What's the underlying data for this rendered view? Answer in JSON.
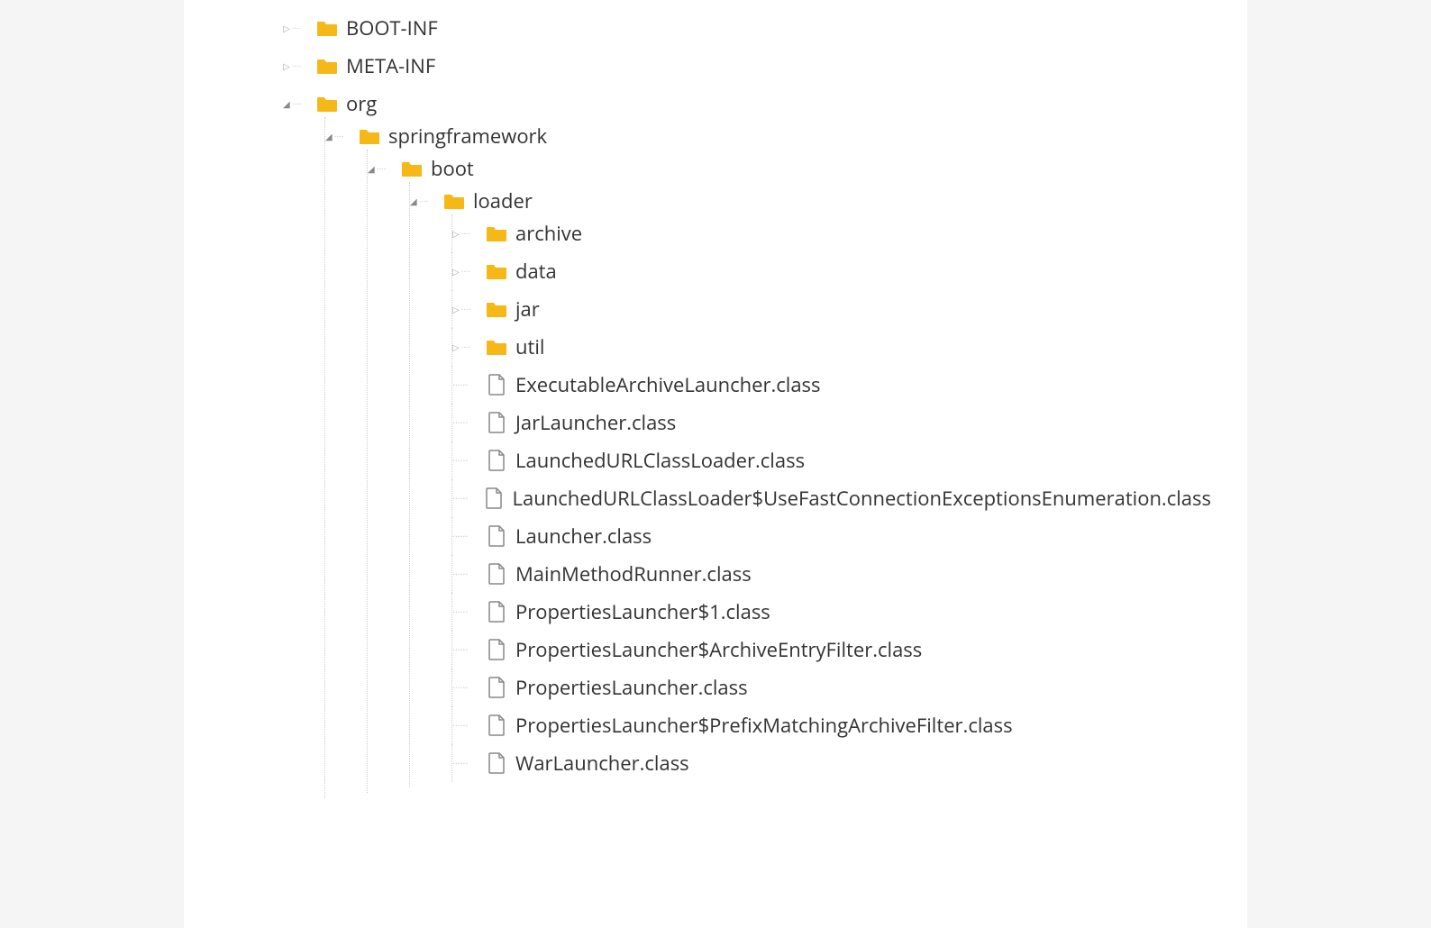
{
  "colors": {
    "folder": "#f5b817",
    "file_stroke": "#888888",
    "text": "#333333"
  },
  "tree": [
    {
      "type": "folder",
      "state": "collapsed",
      "label": "BOOT-INF"
    },
    {
      "type": "folder",
      "state": "collapsed",
      "label": "META-INF"
    },
    {
      "type": "folder",
      "state": "expanded",
      "label": "org",
      "children": [
        {
          "type": "folder",
          "state": "expanded",
          "label": "springframework",
          "children": [
            {
              "type": "folder",
              "state": "expanded",
              "label": "boot",
              "children": [
                {
                  "type": "folder",
                  "state": "expanded",
                  "label": "loader",
                  "children": [
                    {
                      "type": "folder",
                      "state": "collapsed",
                      "label": "archive"
                    },
                    {
                      "type": "folder",
                      "state": "collapsed",
                      "label": "data"
                    },
                    {
                      "type": "folder",
                      "state": "collapsed",
                      "label": "jar"
                    },
                    {
                      "type": "folder",
                      "state": "collapsed",
                      "label": "util"
                    },
                    {
                      "type": "file",
                      "label": "ExecutableArchiveLauncher.class"
                    },
                    {
                      "type": "file",
                      "label": "JarLauncher.class"
                    },
                    {
                      "type": "file",
                      "label": "LaunchedURLClassLoader.class"
                    },
                    {
                      "type": "file",
                      "label": "LaunchedURLClassLoader$UseFastConnectionExceptionsEnumeration.class"
                    },
                    {
                      "type": "file",
                      "label": "Launcher.class"
                    },
                    {
                      "type": "file",
                      "label": "MainMethodRunner.class"
                    },
                    {
                      "type": "file",
                      "label": "PropertiesLauncher$1.class"
                    },
                    {
                      "type": "file",
                      "label": "PropertiesLauncher$ArchiveEntryFilter.class"
                    },
                    {
                      "type": "file",
                      "label": "PropertiesLauncher.class"
                    },
                    {
                      "type": "file",
                      "label": "PropertiesLauncher$PrefixMatchingArchiveFilter.class"
                    },
                    {
                      "type": "file",
                      "label": "WarLauncher.class"
                    }
                  ]
                }
              ]
            }
          ]
        }
      ]
    }
  ]
}
